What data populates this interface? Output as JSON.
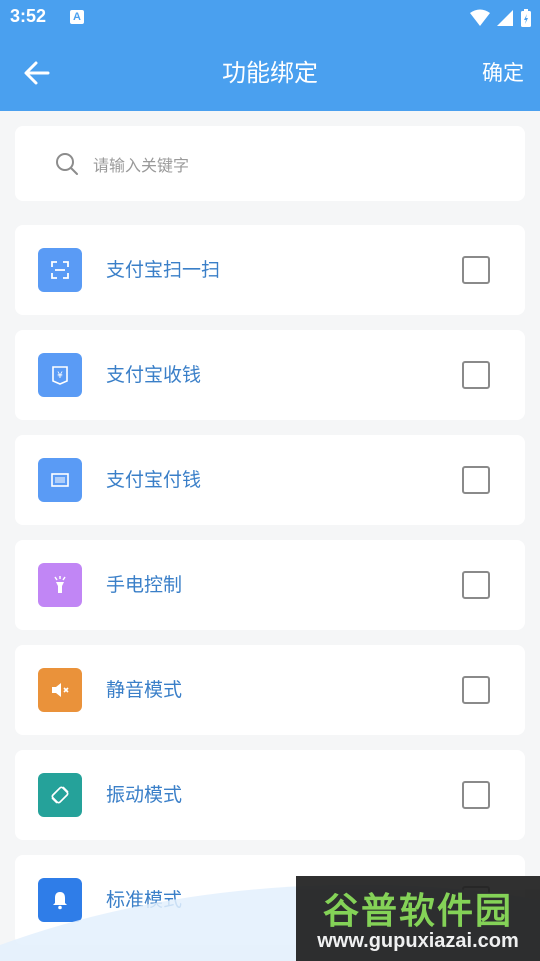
{
  "status_bar": {
    "time": "3:52",
    "notification_badge": "A"
  },
  "app_bar": {
    "title": "功能绑定",
    "confirm_label": "确定"
  },
  "search": {
    "placeholder": "请输入关键字",
    "value": ""
  },
  "items": [
    {
      "label": "支付宝扫一扫",
      "icon": "scan-icon",
      "color": "#5a9bf5",
      "checked": false
    },
    {
      "label": "支付宝收钱",
      "icon": "receive-money-icon",
      "color": "#5a9bf5",
      "checked": false
    },
    {
      "label": "支付宝付钱",
      "icon": "barcode-icon",
      "color": "#5a9bf5",
      "checked": false
    },
    {
      "label": "手电控制",
      "icon": "flashlight-icon",
      "color": "#c186f5",
      "checked": false
    },
    {
      "label": "静音模式",
      "icon": "mute-icon",
      "color": "#ea923a",
      "checked": false
    },
    {
      "label": "振动模式",
      "icon": "vibrate-icon",
      "color": "#25a29a",
      "checked": false
    },
    {
      "label": "标准模式",
      "icon": "bell-icon",
      "color": "#2f7de8",
      "checked": false
    }
  ],
  "watermark": {
    "text_cn": "谷普软件园",
    "text_en": "www.gupuxiazai.com"
  },
  "colors": {
    "primary": "#4aa0ef",
    "label": "#3a7fc8",
    "background": "#f5f6f7"
  }
}
